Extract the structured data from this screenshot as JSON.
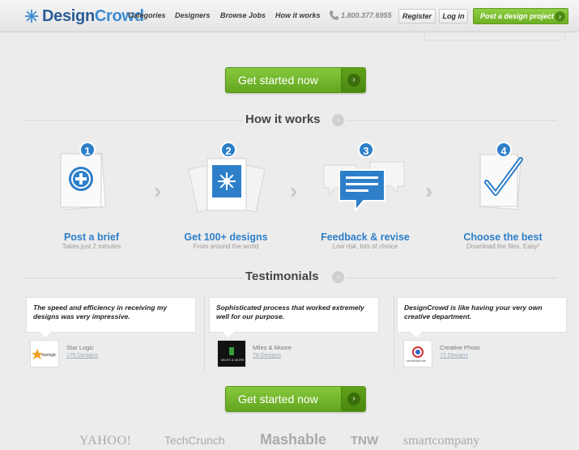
{
  "header": {
    "logo_design": "Design",
    "logo_crowd": "Crowd",
    "nav": [
      "Categories",
      "Designers",
      "Browse Jobs",
      "How it works"
    ],
    "phone": "1.800.377.6955",
    "register": "Register",
    "login": "Log in",
    "post_project": "Post a design project"
  },
  "cta_label": "Get started now",
  "how_it_works": {
    "title": "How it works",
    "steps": [
      {
        "num": "1",
        "title": "Post a brief",
        "sub": "Takes just 2 minutes",
        "icon": "plus-circle-icon"
      },
      {
        "num": "2",
        "title": "Get 100+ designs",
        "sub": "From around the world",
        "icon": "design-sheets-icon"
      },
      {
        "num": "3",
        "title": "Feedback & revise",
        "sub": "Low risk, lots of choice",
        "icon": "chat-bubble-icon"
      },
      {
        "num": "4",
        "title": "Choose the best",
        "sub": "Download the files. Easy!",
        "icon": "checkmark-icon"
      }
    ]
  },
  "testimonials": {
    "title": "Testimonials",
    "items": [
      {
        "quote": "The speed and efficiency in receiving my designs was very impressive.",
        "name": "Star Logic",
        "designs": "175 Designs",
        "logo_text": "starlogic"
      },
      {
        "quote": "Sophisticated process that worked extremely well for our purpose.",
        "name": "Miles & Moore",
        "designs": "78 Designs",
        "logo_text": "MILES & MORE"
      },
      {
        "quote": "DesignCrowd is like having your very own creative department.",
        "name": "Creative Photo",
        "designs": "72 Designs",
        "logo_text": "creativephoto"
      }
    ]
  },
  "press": [
    "YAHOO!",
    "TechCrunch",
    "Mashable",
    "TNW",
    "smartcompany"
  ],
  "colors": {
    "accent_blue": "#2d7fc9",
    "cta_green": "#6faf26"
  }
}
